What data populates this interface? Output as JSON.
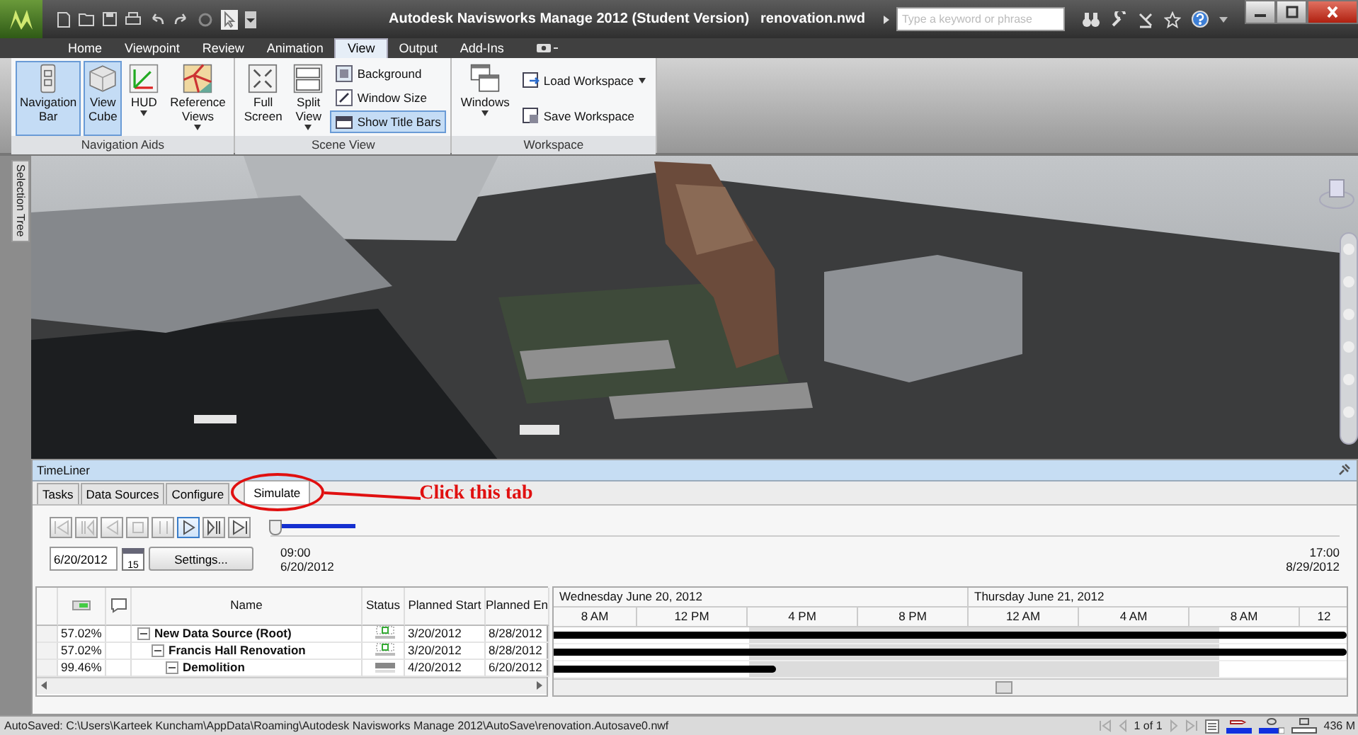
{
  "title_bar": {
    "title": "Autodesk Navisworks Manage 2012 (Student Version)",
    "file": "renovation.nwd",
    "search": {
      "placeholder": "Type a keyword or phrase"
    }
  },
  "ribbon": {
    "tabs": [
      {
        "label": "Home",
        "selected": false
      },
      {
        "label": "Viewpoint",
        "selected": false
      },
      {
        "label": "Review",
        "selected": false
      },
      {
        "label": "Animation",
        "selected": false
      },
      {
        "label": "View",
        "selected": true
      },
      {
        "label": "Output",
        "selected": false
      },
      {
        "label": "Add-Ins",
        "selected": false
      }
    ],
    "groups": [
      {
        "title": "Navigation Aids",
        "items": [
          {
            "kind": "large",
            "label": "Navigation\nBar",
            "active": true,
            "dropdown": false
          },
          {
            "kind": "large",
            "label": "View\nCube",
            "active": true,
            "dropdown": false
          },
          {
            "kind": "large",
            "label": "HUD",
            "active": false,
            "dropdown": true
          },
          {
            "kind": "large",
            "label": "Reference\nViews",
            "active": false,
            "dropdown": true
          }
        ]
      },
      {
        "title": "Scene View",
        "items": [
          {
            "kind": "large",
            "label": "Full\nScreen",
            "active": false,
            "dropdown": false
          },
          {
            "kind": "large",
            "label": "Split\nView",
            "active": false,
            "dropdown": true
          },
          {
            "kind": "small",
            "label": "Background",
            "active": false,
            "dropdown": false
          },
          {
            "kind": "small",
            "label": "Window Size",
            "active": false,
            "dropdown": false
          },
          {
            "kind": "small",
            "label": "Show Title Bars",
            "active": true,
            "dropdown": false
          }
        ]
      },
      {
        "title": "Workspace",
        "items": [
          {
            "kind": "large",
            "label": "Windows",
            "active": false,
            "dropdown": true
          },
          {
            "kind": "small",
            "label": "Load Workspace",
            "active": false,
            "dropdown": true
          },
          {
            "kind": "small",
            "label": "Save Workspace",
            "active": false,
            "dropdown": false
          }
        ]
      }
    ]
  },
  "side_tab": {
    "label": "Selection Tree"
  },
  "timeliner": {
    "title": "TimeLiner",
    "tabs": [
      {
        "label": "Tasks",
        "selected": false
      },
      {
        "label": "Data Sources",
        "selected": false
      },
      {
        "label": "Configure",
        "selected": false
      },
      {
        "label": "Simulate",
        "selected": true
      }
    ],
    "annotation": {
      "text": "Click this tab"
    },
    "playback": [
      {
        "disabled": true,
        "highlighted": false
      },
      {
        "disabled": true,
        "highlighted": false
      },
      {
        "disabled": true,
        "highlighted": false
      },
      {
        "disabled": true,
        "highlighted": false
      },
      {
        "disabled": true,
        "highlighted": false
      },
      {
        "disabled": false,
        "highlighted": true
      },
      {
        "disabled": false,
        "highlighted": false
      },
      {
        "disabled": false,
        "highlighted": false
      }
    ],
    "slider": {
      "level": 0
    },
    "date": "6/20/2012",
    "calendar_day": "15",
    "settings": "Settings...",
    "start": {
      "time": "09:00",
      "date": "6/20/2012"
    },
    "end": {
      "time": "17:00",
      "date": "8/29/2012"
    },
    "columns": [
      "Name",
      "Status",
      "Planned Start",
      "Planned En"
    ],
    "days": [
      {
        "label": "Wednesday June 20, 2012",
        "hours": [
          "8 AM",
          "12 PM",
          "4 PM",
          "8 PM"
        ]
      },
      {
        "label": "Thursday June 21, 2012",
        "hours": [
          "12 AM",
          "4 AM",
          "8 AM",
          "12"
        ]
      }
    ],
    "tasks": [
      {
        "progress": "57.02%",
        "name": "New Data Source (Root)",
        "expanded": true,
        "kind": "in_progress",
        "start": "3/20/2012",
        "end": "8/28/2012",
        "bar": {
          "level": 1
        },
        "children": [
          {
            "progress": "57.02%",
            "name": "Francis Hall Renovation",
            "expanded": true,
            "kind": "in_progress",
            "start": "3/20/2012",
            "end": "8/28/2012",
            "bar": {
              "level": 1
            },
            "children": [
              {
                "progress": "99.46%",
                "name": "Demolition",
                "expanded": true,
                "kind": "finished",
                "start": "4/20/2012",
                "end": "6/20/2012",
                "bar": {
                  "level": 0.28
                }
              }
            ]
          }
        ]
      }
    ]
  },
  "status_bar": {
    "message": "AutoSaved: C:\\Users\\Karteek Kuncham\\AppData\\Roaming\\Autodesk Navisworks Manage 2012\\AutoSave\\renovation.Autosave0.nwf",
    "page": "1 of 1",
    "memory": "436 M"
  }
}
